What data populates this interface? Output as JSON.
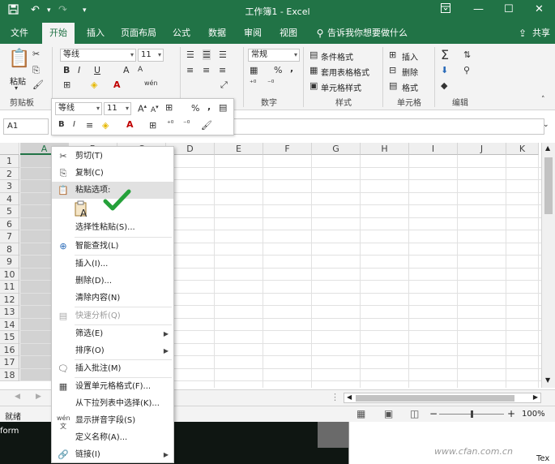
{
  "titlebar": {
    "title": "工作簿1 - Excel",
    "save_icon": "save-icon",
    "undo_icon": "undo-icon",
    "redo_icon": "redo-icon"
  },
  "tabs": [
    {
      "label": "文件"
    },
    {
      "label": "开始"
    },
    {
      "label": "插入"
    },
    {
      "label": "页面布局"
    },
    {
      "label": "公式"
    },
    {
      "label": "数据"
    },
    {
      "label": "审阅"
    },
    {
      "label": "视图"
    }
  ],
  "tell_me": "告诉我你想要做什么",
  "share": "共享",
  "ribbon": {
    "clipboard": {
      "paste": "粘贴",
      "label": "剪贴板"
    },
    "font": {
      "name": "等线",
      "size": "11",
      "bold": "B",
      "italic": "I",
      "underline": "U",
      "grow": "A",
      "shrink": "A",
      "wen": "wén"
    },
    "number": {
      "format": "常规",
      "percent": "%",
      "comma": ",",
      "label": "数字"
    },
    "styles": {
      "conditional": "条件格式",
      "table": "套用表格格式",
      "cell": "单元格样式",
      "label": "样式"
    },
    "cells": {
      "insert": "插入",
      "delete": "删除",
      "format": "格式",
      "label": "单元格"
    },
    "editing": {
      "label": "编辑"
    }
  },
  "formula_bar": {
    "name_box": "A1"
  },
  "grid": {
    "columns": [
      "A",
      "B",
      "C",
      "D",
      "E",
      "F",
      "G",
      "H",
      "I",
      "J",
      "K"
    ],
    "rows": [
      "1",
      "2",
      "3",
      "4",
      "5",
      "6",
      "7",
      "8",
      "9",
      "10",
      "11",
      "12",
      "13",
      "14",
      "15",
      "16",
      "17",
      "18"
    ]
  },
  "mini_toolbar": {
    "font": "等线",
    "size": "11",
    "bold": "B",
    "italic": "I",
    "percent": "%",
    "comma": ","
  },
  "context_menu": {
    "cut": "剪切(T)",
    "copy": "复制(C)",
    "paste_options": "粘贴选项:",
    "paste_special": "选择性粘贴(S)...",
    "smart_lookup": "智能查找(L)",
    "insert": "插入(I)...",
    "delete": "删除(D)...",
    "clear": "清除内容(N)",
    "quick_analysis": "快速分析(Q)",
    "filter": "筛选(E)",
    "sort": "排序(O)",
    "insert_comment": "插入批注(M)",
    "format_cells": "设置单元格格式(F)...",
    "pick_list": "从下拉列表中选择(K)...",
    "phonetic": "显示拼音字段(S)",
    "define_name": "定义名称(A)...",
    "link": "链接(I)"
  },
  "statusbar": {
    "ready": "就绪",
    "zoom": "100%"
  },
  "bg_text": {
    "form": "form",
    "tex": "Tex",
    "watermark": "www.cfan.com.cn"
  }
}
